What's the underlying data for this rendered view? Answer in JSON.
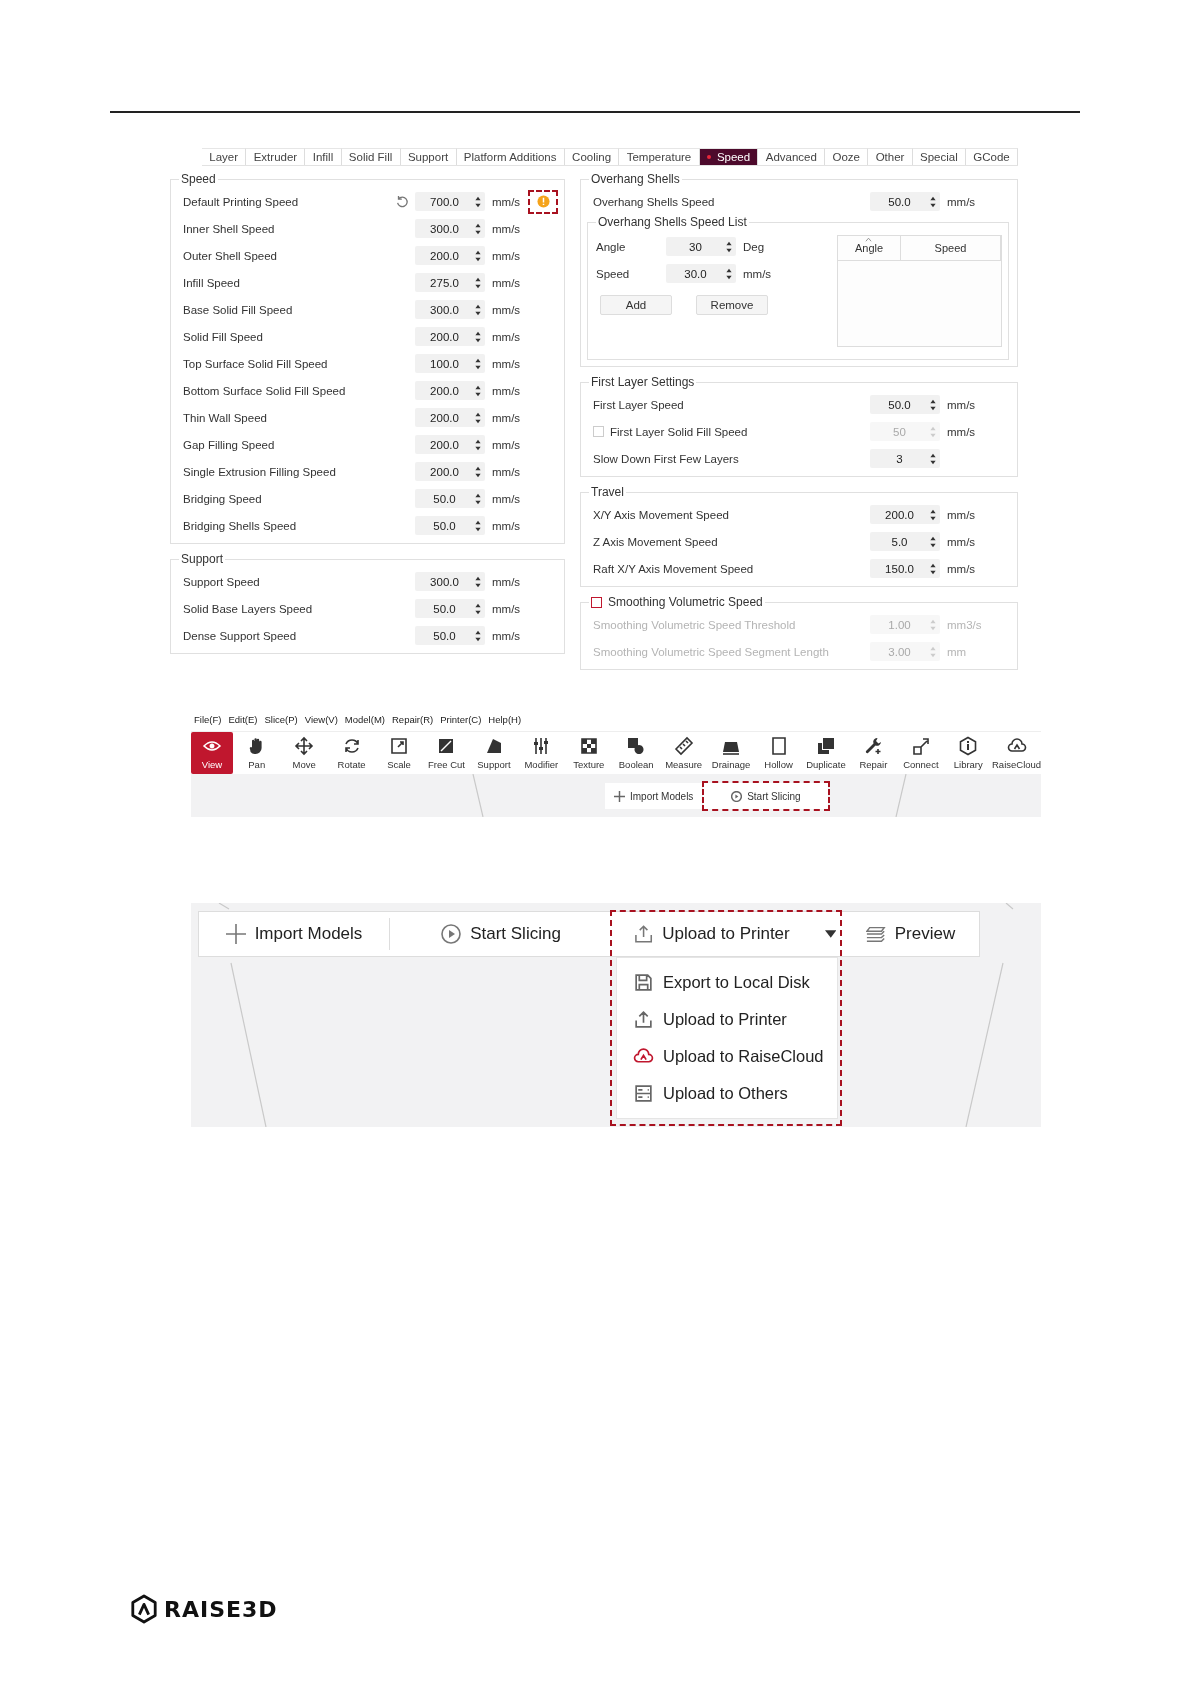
{
  "settings": {
    "tabs": [
      {
        "label": "Layer",
        "selected": false,
        "modified": false
      },
      {
        "label": "Extruder",
        "selected": false,
        "modified": false
      },
      {
        "label": "Infill",
        "selected": false,
        "modified": false
      },
      {
        "label": "Solid Fill",
        "selected": false,
        "modified": false
      },
      {
        "label": "Support",
        "selected": false,
        "modified": false
      },
      {
        "label": "Platform Additions",
        "selected": false,
        "modified": false
      },
      {
        "label": "Cooling",
        "selected": false,
        "modified": false
      },
      {
        "label": "Temperature",
        "selected": false,
        "modified": false
      },
      {
        "label": "Speed",
        "selected": true,
        "modified": true
      },
      {
        "label": "Advanced",
        "selected": false,
        "modified": false
      },
      {
        "label": "Ooze",
        "selected": false,
        "modified": false
      },
      {
        "label": "Other",
        "selected": false,
        "modified": false
      },
      {
        "label": "Special",
        "selected": false,
        "modified": false
      },
      {
        "label": "GCode",
        "selected": false,
        "modified": false
      }
    ],
    "speed": {
      "title": "Speed",
      "rows": [
        {
          "label": "Default Printing Speed",
          "value": "700.0",
          "unit": "mm/s",
          "reset": true,
          "warning": true,
          "highlighted": true
        },
        {
          "label": "Inner Shell Speed",
          "value": "300.0",
          "unit": "mm/s",
          "reset": false,
          "warning": false,
          "highlighted": false
        },
        {
          "label": "Outer Shell Speed",
          "value": "200.0",
          "unit": "mm/s",
          "reset": false,
          "warning": false,
          "highlighted": false
        },
        {
          "label": "Infill Speed",
          "value": "275.0",
          "unit": "mm/s",
          "reset": false,
          "warning": false,
          "highlighted": false
        },
        {
          "label": "Base Solid Fill Speed",
          "value": "300.0",
          "unit": "mm/s",
          "reset": false,
          "warning": false,
          "highlighted": false
        },
        {
          "label": "Solid Fill Speed",
          "value": "200.0",
          "unit": "mm/s",
          "reset": false,
          "warning": false,
          "highlighted": false
        },
        {
          "label": "Top Surface Solid Fill Speed",
          "value": "100.0",
          "unit": "mm/s",
          "reset": false,
          "warning": false,
          "highlighted": false
        },
        {
          "label": "Bottom Surface Solid Fill Speed",
          "value": "200.0",
          "unit": "mm/s",
          "reset": false,
          "warning": false,
          "highlighted": false
        },
        {
          "label": "Thin Wall Speed",
          "value": "200.0",
          "unit": "mm/s",
          "reset": false,
          "warning": false,
          "highlighted": false
        },
        {
          "label": "Gap Filling Speed",
          "value": "200.0",
          "unit": "mm/s",
          "reset": false,
          "warning": false,
          "highlighted": false
        },
        {
          "label": "Single Extrusion Filling Speed",
          "value": "200.0",
          "unit": "mm/s",
          "reset": false,
          "warning": false,
          "highlighted": false
        },
        {
          "label": "Bridging Speed",
          "value": "50.0",
          "unit": "mm/s",
          "reset": false,
          "warning": false,
          "highlighted": false
        },
        {
          "label": "Bridging Shells Speed",
          "value": "50.0",
          "unit": "mm/s",
          "reset": false,
          "warning": false,
          "highlighted": false
        }
      ]
    },
    "support": {
      "title": "Support",
      "rows": [
        {
          "label": "Support Speed",
          "value": "300.0",
          "unit": "mm/s"
        },
        {
          "label": "Solid Base Layers Speed",
          "value": "50.0",
          "unit": "mm/s"
        },
        {
          "label": "Dense Support Speed",
          "value": "50.0",
          "unit": "mm/s"
        }
      ]
    },
    "overhang": {
      "title": "Overhang Shells",
      "rows": [
        {
          "label": "Overhang Shells Speed",
          "value": "50.0",
          "unit": "mm/s"
        }
      ],
      "speed_list": {
        "title": "Overhang Shells Speed List",
        "fields": [
          {
            "label": "Angle",
            "value": "30",
            "unit": "Deg"
          },
          {
            "label": "Speed",
            "value": "30.0",
            "unit": "mm/s"
          }
        ],
        "buttons": [
          "Add",
          "Remove"
        ],
        "columns": [
          {
            "label": "Angle",
            "sorted": true
          },
          {
            "label": "Speed",
            "sorted": false
          }
        ]
      }
    },
    "first_layer": {
      "title": "First Layer Settings",
      "rows": [
        {
          "kind": "spin",
          "label": "First Layer Speed",
          "value": "50.0",
          "unit": "mm/s",
          "disabled": false
        },
        {
          "kind": "checkbox",
          "label": "First Layer Solid Fill Speed",
          "checked": false,
          "value": "50",
          "unit": "mm/s",
          "disabled": true
        },
        {
          "kind": "spin",
          "label": "Slow Down First Few Layers",
          "value": "3",
          "disabled": false
        }
      ]
    },
    "travel": {
      "title": "Travel",
      "rows": [
        {
          "label": "X/Y Axis Movement Speed",
          "value": "200.0",
          "unit": "mm/s"
        },
        {
          "label": "Z Axis Movement Speed",
          "value": "5.0",
          "unit": "mm/s"
        },
        {
          "label": "Raft X/Y Axis Movement Speed",
          "value": "150.0",
          "unit": "mm/s"
        }
      ]
    },
    "smoothing": {
      "title": "Smoothing Volumetric Speed",
      "checked": false,
      "rows": [
        {
          "label": "Smoothing Volumetric Speed Threshold",
          "value": "1.00",
          "unit": "mm3/s",
          "disabled": true
        },
        {
          "label": "Smoothing Volumetric Speed Segment Length",
          "value": "3.00",
          "unit": "mm",
          "disabled": true
        }
      ]
    }
  },
  "toolbar_window": {
    "menu": [
      "File(F)",
      "Edit(E)",
      "Slice(P)",
      "View(V)",
      "Model(M)",
      "Repair(R)",
      "Printer(C)",
      "Help(H)"
    ],
    "tools": [
      {
        "label": "View",
        "selected": true
      },
      {
        "label": "Pan",
        "selected": false
      },
      {
        "label": "Move",
        "selected": false
      },
      {
        "label": "Rotate",
        "selected": false
      },
      {
        "label": "Scale",
        "selected": false
      },
      {
        "label": "Free Cut",
        "selected": false
      },
      {
        "label": "Support",
        "selected": false
      },
      {
        "label": "Modifier",
        "selected": false
      },
      {
        "label": "Texture",
        "selected": false
      },
      {
        "label": "Boolean",
        "selected": false
      },
      {
        "label": "Measure",
        "selected": false
      },
      {
        "label": "Drainage",
        "selected": false
      },
      {
        "label": "Hollow",
        "selected": false
      },
      {
        "label": "Duplicate",
        "selected": false
      },
      {
        "label": "Repair",
        "selected": false
      },
      {
        "label": "Connect",
        "selected": false
      },
      {
        "label": "Library",
        "selected": false
      },
      {
        "label": "RaiseCloud",
        "selected": false
      }
    ],
    "actions": [
      {
        "label": "Import Models",
        "highlighted": false
      },
      {
        "label": "Start Slicing",
        "highlighted": true
      }
    ]
  },
  "export_window": {
    "import_button": {
      "label": "Import Models"
    },
    "slice_button": {
      "label": "Start Slicing"
    },
    "upload_button": {
      "label": "Upload to Printer",
      "expanded": true,
      "highlighted": true,
      "menu": [
        "Export to Local Disk",
        "Upload to Printer",
        "Upload to RaiseCloud",
        "Upload to Others"
      ]
    },
    "preview_button": {
      "label": "Preview"
    }
  },
  "footer": {
    "logo": "RAISE3D"
  }
}
